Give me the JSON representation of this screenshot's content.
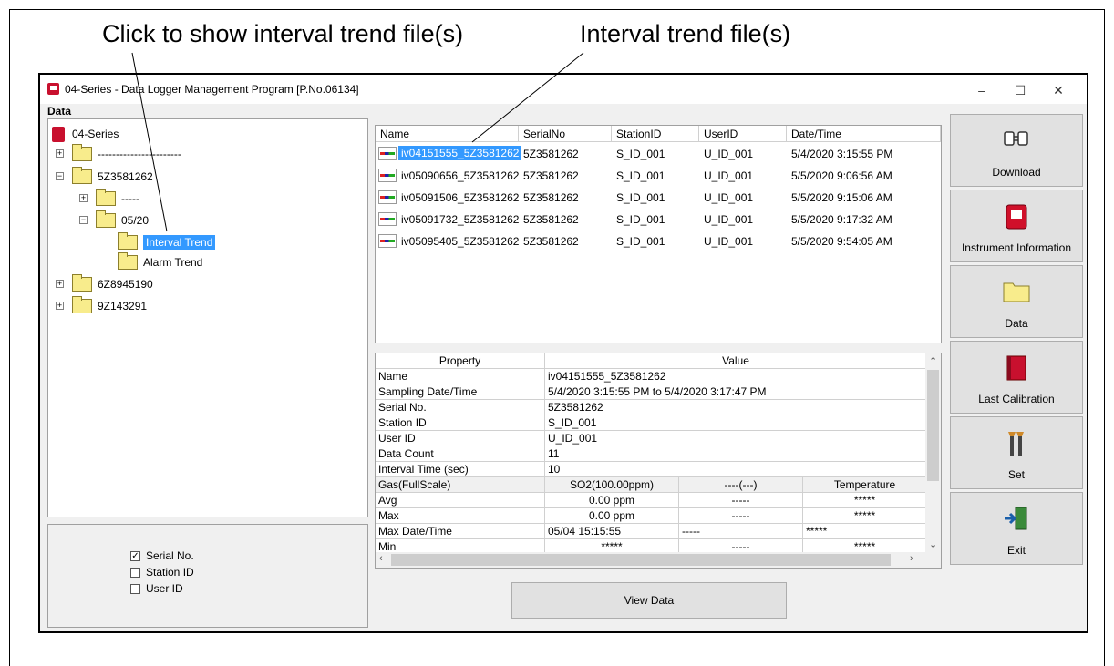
{
  "annotations": {
    "left": "Click to show interval trend file(s)",
    "right": "Interval trend file(s)"
  },
  "window": {
    "title": "04-Series - Data Logger Management Program [P.No.06134]",
    "controls": [
      "–",
      "☐",
      "✕"
    ]
  },
  "data_group_label": "Data",
  "tree": {
    "root": "04-Series",
    "n1": "-----------------------",
    "n2": "5Z3581262",
    "n2a": "-----",
    "n2b": "05/20",
    "n2b1": "Interval Trend",
    "n2b2": "Alarm Trend",
    "n3": "6Z8945190",
    "n4": "9Z143291"
  },
  "checkboxes": [
    {
      "label": "Serial No.",
      "checked": true
    },
    {
      "label": "Station ID",
      "checked": false
    },
    {
      "label": "User ID",
      "checked": false
    }
  ],
  "file_list": {
    "headers": [
      "Name",
      "SerialNo",
      "StationID",
      "UserID",
      "Date/Time"
    ],
    "rows": [
      [
        "iv04151555_5Z3581262",
        "5Z3581262",
        "S_ID_001",
        "U_ID_001",
        "5/4/2020 3:15:55 PM"
      ],
      [
        "iv05090656_5Z3581262",
        "5Z3581262",
        "S_ID_001",
        "U_ID_001",
        "5/5/2020 9:06:56 AM"
      ],
      [
        "iv05091506_5Z3581262",
        "5Z3581262",
        "S_ID_001",
        "U_ID_001",
        "5/5/2020 9:15:06 AM"
      ],
      [
        "iv05091732_5Z3581262",
        "5Z3581262",
        "S_ID_001",
        "U_ID_001",
        "5/5/2020 9:17:32 AM"
      ],
      [
        "iv05095405_5Z3581262",
        "5Z3581262",
        "S_ID_001",
        "U_ID_001",
        "5/5/2020 9:54:05 AM"
      ]
    ]
  },
  "properties": {
    "header_property": "Property",
    "header_value": "Value",
    "rows": [
      [
        "Name",
        "iv04151555_5Z3581262"
      ],
      [
        "Sampling Date/Time",
        "5/4/2020 3:15:55 PM to 5/4/2020 3:17:47 PM"
      ],
      [
        "Serial No.",
        "5Z3581262"
      ],
      [
        "Station ID",
        "S_ID_001"
      ],
      [
        "User ID",
        "U_ID_001"
      ],
      [
        "Data Count",
        "11"
      ],
      [
        "Interval Time (sec)",
        "10"
      ]
    ],
    "gas_row": [
      "Gas(FullScale)",
      "SO2(100.00ppm)",
      "----(---)",
      "Temperature"
    ],
    "avg_row": [
      "Avg",
      "0.00 ppm",
      "-----",
      "*****"
    ],
    "max_row": [
      "Max",
      "0.00 ppm",
      "-----",
      "*****"
    ],
    "maxdt_row": [
      "Max Date/Time",
      "05/04 15:15:55",
      "-----",
      "*****"
    ],
    "min_row": [
      "Min",
      "*****",
      "-----",
      "*****"
    ]
  },
  "view_button": "View Data",
  "side_buttons": [
    {
      "label": "Download",
      "icon": "download-icon"
    },
    {
      "label": "Instrument Information",
      "icon": "instrument-icon"
    },
    {
      "label": "Data",
      "icon": "folder-icon"
    },
    {
      "label": "Last Calibration",
      "icon": "calibration-book-icon"
    },
    {
      "label": "Set",
      "icon": "tools-icon"
    },
    {
      "label": "Exit",
      "icon": "exit-door-icon"
    }
  ]
}
